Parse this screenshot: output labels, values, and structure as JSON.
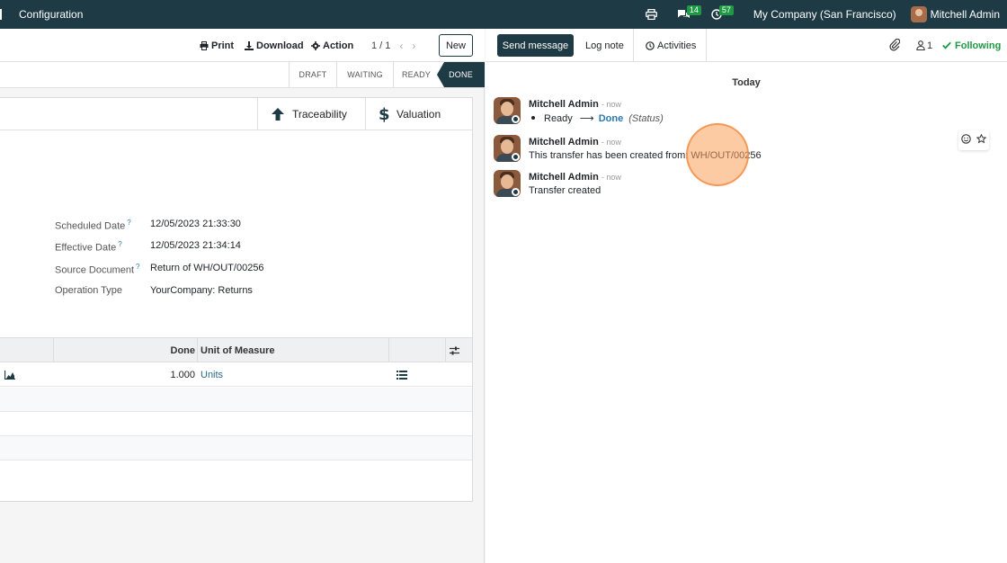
{
  "navbar": {
    "menu_label": "Configuration",
    "messages_count": "14",
    "activities_count": "57",
    "company": "My Company (San Francisco)",
    "user_name": "Mitchell Admin"
  },
  "control": {
    "print_label": "Print",
    "download_label": "Download",
    "action_label": "Action",
    "pager": "1 / 1",
    "new_label": "New"
  },
  "stages": [
    {
      "label": "DRAFT",
      "active": false
    },
    {
      "label": "WAITING",
      "active": false
    },
    {
      "label": "READY",
      "active": false
    },
    {
      "label": "DONE",
      "active": true
    }
  ],
  "smart_buttons": {
    "traceability": "Traceability",
    "valuation": "Valuation"
  },
  "fields": [
    {
      "label": "Scheduled Date",
      "help": "?",
      "value": "12/05/2023 21:33:30"
    },
    {
      "label": "Effective Date",
      "help": "?",
      "value": "12/05/2023 21:34:14"
    },
    {
      "label": "Source Document",
      "help": "?",
      "value": "Return of WH/OUT/00256"
    },
    {
      "label": "Operation Type",
      "help": "",
      "value": "YourCompany: Returns"
    }
  ],
  "table": {
    "headers": {
      "done": "Done",
      "uom": "Unit of Measure"
    },
    "rows": [
      {
        "done": "1.000",
        "uom": "Units"
      }
    ]
  },
  "chatter": {
    "send_label": "Send message",
    "log_label": "Log note",
    "activities_label": "Activities",
    "followers_count": "1",
    "following_label": "Following",
    "date_separator": "Today",
    "messages": [
      {
        "author": "Mitchell Admin",
        "time": "- now",
        "from": "Ready",
        "to": "Done",
        "field": "(Status)"
      },
      {
        "author": "Mitchell Admin",
        "time": "- now",
        "text": "This transfer has been created from: WH/OUT/00256"
      },
      {
        "author": "Mitchell Admin",
        "time": "- now",
        "text": "Transfer created"
      }
    ]
  },
  "colors": {
    "navbar": "#1e3a44",
    "accent": "#1e3a44",
    "following": "#1e9a44",
    "link": "#2a7ab0"
  }
}
